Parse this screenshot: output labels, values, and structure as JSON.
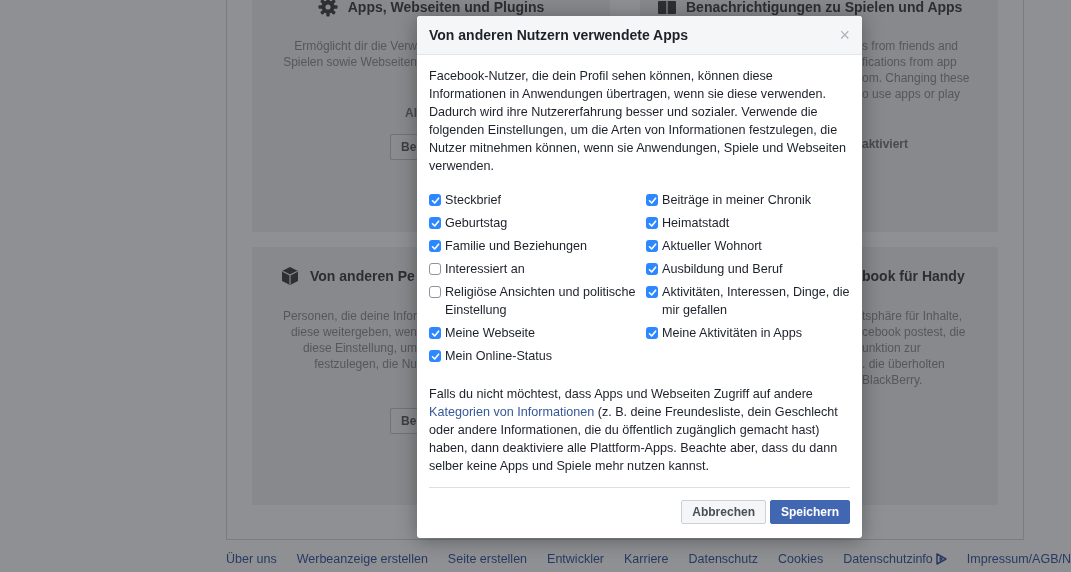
{
  "background": {
    "cards": [
      {
        "heading": "Apps, Webseiten und Plugins",
        "lines": [
          "Ermöglicht dir die Verw",
          "Spielen sowie Webseiten"
        ],
        "note": "Al",
        "button": "Be"
      },
      {
        "heading": "Benachrichtigungen zu Spielen und Apps",
        "lines": [
          "s from friends and",
          "fications from app",
          "om. Changing these",
          "o use apps or play"
        ],
        "note": "aktiviert"
      },
      {
        "heading": "Von anderen Pe",
        "lines": [
          "Personen, die deine Infor",
          "diese weitergeben, wen",
          "diese Einstellung, um",
          "festzulegen, die Nu"
        ],
        "button": "Be"
      },
      {
        "heading": "book für Handy",
        "lines": [
          "tsphäre für Inhalte,",
          "cebook postest, die",
          "unktion zur",
          ". die überholten",
          "BlackBerry."
        ]
      }
    ]
  },
  "dialog": {
    "title": "Von anderen Nutzern verwendete Apps",
    "close": "×",
    "intro": "Facebook-Nutzer, die dein Profil sehen können, können diese Informationen in Anwendungen übertragen, wenn sie diese verwenden. Dadurch wird ihre Nutzererfahrung besser und sozialer. Verwende die folgenden Einstellungen, um die Arten von Informationen festzulegen, die Nutzer mitnehmen können, wenn sie Anwendungen, Spiele und Webseiten verwenden.",
    "option_columns": [
      [
        {
          "label": "Steckbrief",
          "checked": true
        },
        {
          "label": "Geburtstag",
          "checked": true
        },
        {
          "label": "Familie und Beziehungen",
          "checked": true
        },
        {
          "label": "Interessiert an",
          "checked": false
        },
        {
          "label": "Religiöse Ansichten und politische Einstellung",
          "checked": false
        },
        {
          "label": "Meine Webseite",
          "checked": true
        },
        {
          "label": "Mein Online-Status",
          "checked": true
        }
      ],
      [
        {
          "label": "Beiträge in meiner Chronik",
          "checked": true
        },
        {
          "label": "Heimatstadt",
          "checked": true
        },
        {
          "label": "Aktueller Wohnort",
          "checked": true
        },
        {
          "label": "Ausbildung und Beruf",
          "checked": true
        },
        {
          "label": "Aktivitäten, Interessen, Dinge, die mir gefallen",
          "checked": true
        },
        {
          "label": "Meine Aktivitäten in Apps",
          "checked": true
        }
      ]
    ],
    "notice": {
      "before": "Falls du nicht möchtest, dass Apps und Webseiten Zugriff auf andere",
      "link": "Kategorien von Informationen",
      "after": "(z. B. deine Freundesliste, dein Geschlecht oder andere Informationen, die du öffentlich zugänglich gemacht hast) haben, dann deaktiviere alle Plattform-Apps. Beachte aber, dass du dann selber keine Apps und Spiele mehr nutzen kannst."
    },
    "buttons": [
      {
        "label": "Abbrechen",
        "kind": "secondary"
      },
      {
        "label": "Speichern",
        "kind": "primary"
      }
    ]
  },
  "footer": {
    "links": [
      {
        "label": "Über uns"
      },
      {
        "label": "Werbeanzeige erstellen"
      },
      {
        "label": "Seite erstellen"
      },
      {
        "label": "Entwickler"
      },
      {
        "label": "Karriere"
      },
      {
        "label": "Datenschutz"
      },
      {
        "label": "Cookies"
      },
      {
        "label": "Datenschutzinfo"
      },
      {
        "label": "Impressum/AGB/N"
      }
    ]
  }
}
